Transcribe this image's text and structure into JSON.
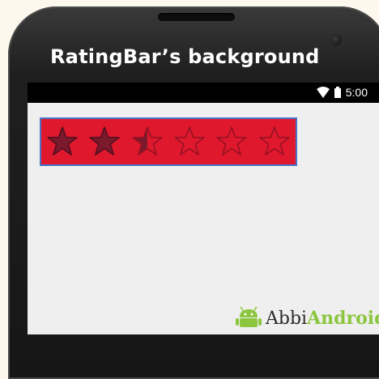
{
  "app": {
    "title": "RatingBar’s background"
  },
  "status_bar": {
    "time": "5:00",
    "icons": [
      "wifi-icon",
      "battery-icon"
    ]
  },
  "rating_bar": {
    "num_stars": 6,
    "rating": 2.5,
    "background_color": "#e0182d",
    "filled_color": "#7a1a2c",
    "empty_stroke_color": "#9b1224"
  },
  "watermark": {
    "text_part1": "Abbi",
    "text_part2": "Android",
    "icon": "android-robot-icon",
    "colors": {
      "part1": "#2b2b2b",
      "part2": "#8cc63f"
    }
  }
}
